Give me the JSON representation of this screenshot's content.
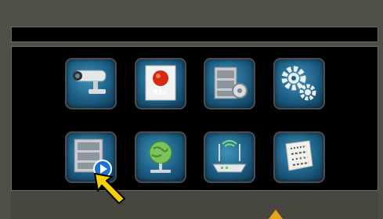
{
  "menu": {
    "items": [
      {
        "icon": "camera-icon"
      },
      {
        "icon": "record-icon",
        "label": "REC"
      },
      {
        "icon": "video-settings-icon"
      },
      {
        "icon": "gear-icon"
      },
      {
        "icon": "playback-icon"
      },
      {
        "icon": "network-icon"
      },
      {
        "icon": "wifi-router-icon"
      },
      {
        "icon": "storage-icon"
      }
    ]
  },
  "colors": {
    "background": "#4f4f47",
    "panel": "#000000",
    "tile": "#1d5e85",
    "cursor": "#f5d000",
    "record": "#d32a10"
  }
}
